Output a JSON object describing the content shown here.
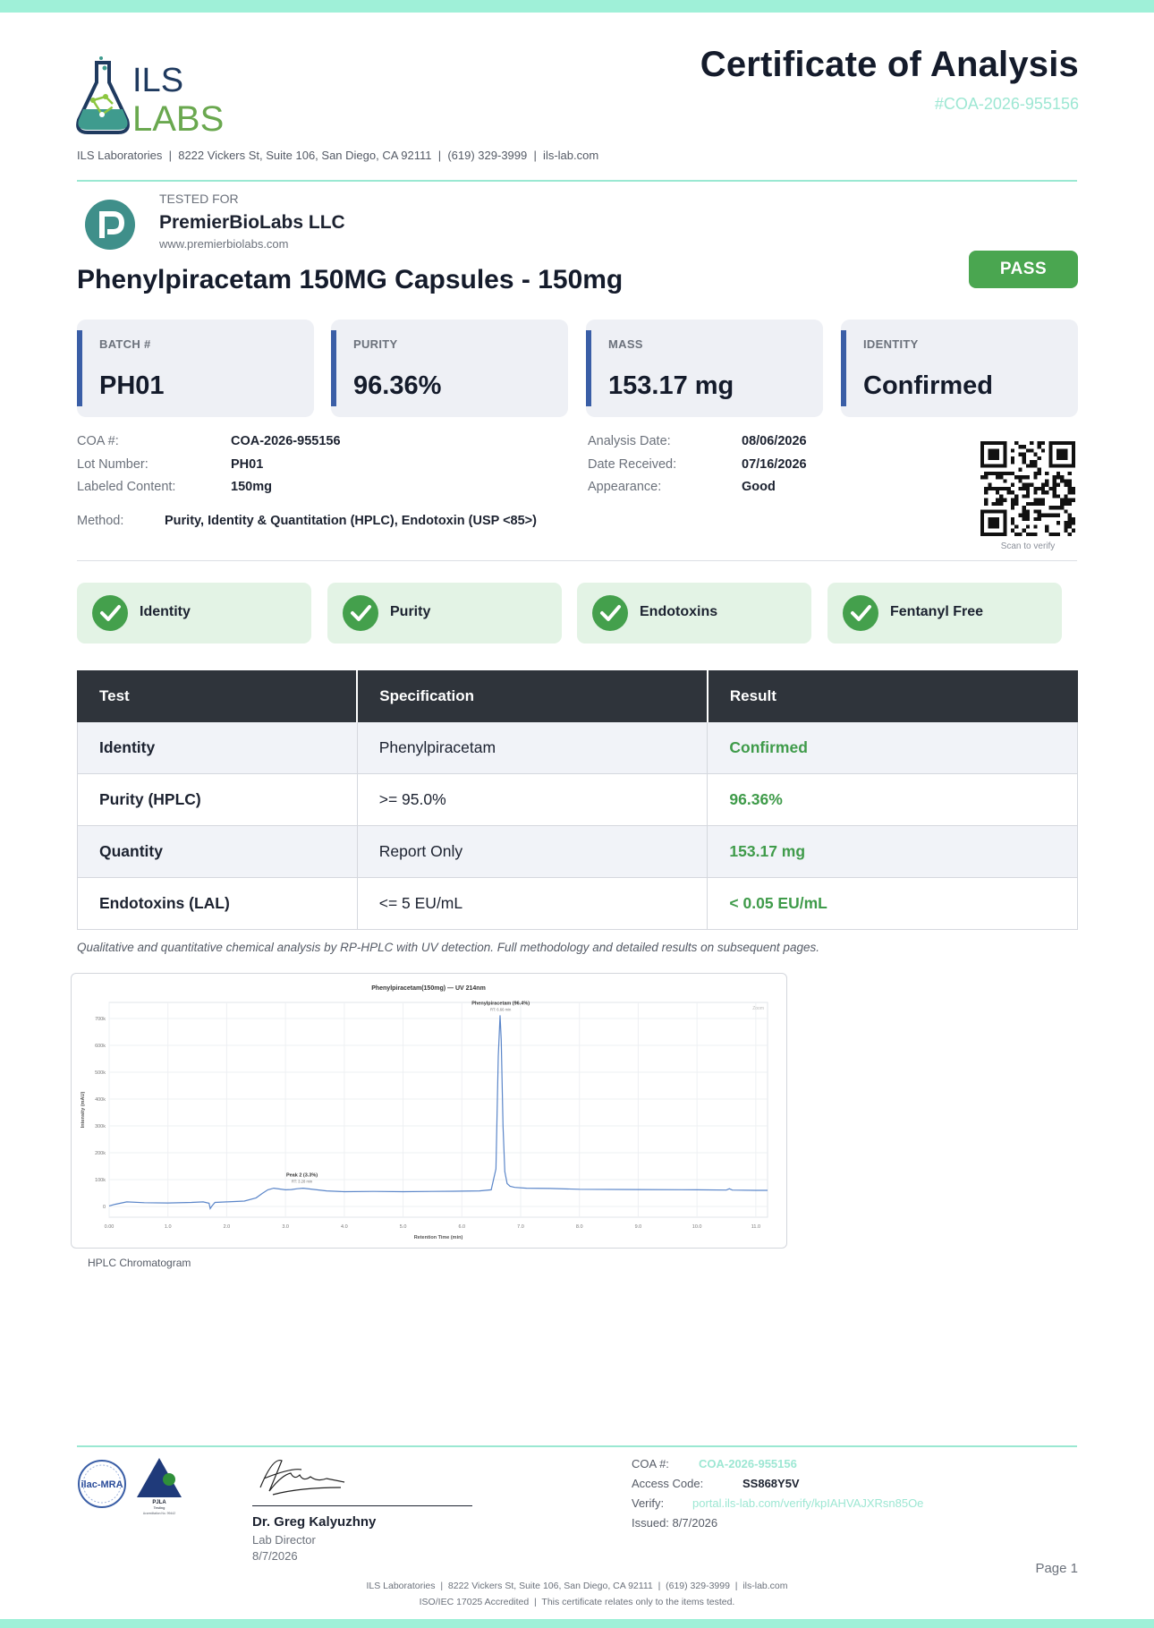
{
  "header": {
    "logo_line1": "ILS",
    "logo_line2": "LABS",
    "title": "Certificate of Analysis",
    "coa_id": "#COA-2026-955156",
    "lab_line": "ILS Laboratories  |  8222 Vickers St, Suite 106, San Diego, CA 92111  |  (619) 329-3999  |  ils-lab.com"
  },
  "client": {
    "tested_for_label": "TESTED FOR",
    "name": "PremierBioLabs LLC",
    "url": "www.premierbiolabs.com"
  },
  "product": {
    "name": "Phenylpiracetam 150MG Capsules - 150mg",
    "status": "PASS"
  },
  "cards": [
    {
      "label": "BATCH #",
      "value": "PH01"
    },
    {
      "label": "PURITY",
      "value": "96.36%"
    },
    {
      "label": "MASS",
      "value": "153.17 mg"
    },
    {
      "label": "IDENTITY",
      "value": "Confirmed"
    }
  ],
  "info_left": [
    {
      "k": "COA #:",
      "v": "COA-2026-955156"
    },
    {
      "k": "Lot Number:",
      "v": "PH01"
    },
    {
      "k": "Labeled Content:",
      "v": "150mg"
    }
  ],
  "info_right": [
    {
      "k": "Analysis Date:",
      "v": "08/06/2026"
    },
    {
      "k": "Date Received:",
      "v": "07/16/2026"
    },
    {
      "k": "Appearance:",
      "v": "Good"
    }
  ],
  "method": {
    "k": "Method:",
    "v": "Purity, Identity & Quantitation (HPLC), Endotoxin (USP <85>)"
  },
  "qr_caption": "Scan to verify",
  "checks": [
    "Identity",
    "Purity",
    "Endotoxins",
    "Fentanyl Free"
  ],
  "table": {
    "headers": [
      "Test",
      "Specification",
      "Result"
    ],
    "rows": [
      {
        "test": "Identity",
        "spec": "Phenylpiracetam",
        "result": "Confirmed"
      },
      {
        "test": "Purity (HPLC)",
        "spec": ">= 95.0%",
        "result": "96.36%"
      },
      {
        "test": "Quantity",
        "spec": "Report Only",
        "result": "153.17 mg"
      },
      {
        "test": "Endotoxins (LAL)",
        "spec": "<= 5 EU/mL",
        "result": "< 0.05 EU/mL"
      }
    ]
  },
  "note": "Qualitative and quantitative chemical analysis by RP-HPLC with UV detection. Full methodology and detailed results on subsequent pages.",
  "chart_data": {
    "type": "line",
    "title": "Phenylpiracetam(150mg) — UV 214nm",
    "xlabel": "Retention Time (min)",
    "ylabel": "Intensity (mAU)",
    "xlim": [
      0,
      11.2
    ],
    "ylim": [
      -40000,
      760000
    ],
    "x_ticks": [
      "0.00",
      "1.0",
      "2.0",
      "3.0",
      "4.0",
      "5.0",
      "6.0",
      "7.0",
      "8.0",
      "9.0",
      "10.0",
      "11.0"
    ],
    "y_ticks": [
      "0",
      "100k",
      "200k",
      "300k",
      "400k",
      "500k",
      "600k",
      "700k"
    ],
    "grid": true,
    "corner_label": "Zoom",
    "annotations": [
      {
        "label": "Phenylpiracetam (96.4%)",
        "sub": "RT: 6.66 min",
        "x": 6.66,
        "y": 712000
      },
      {
        "label": "Peak 2 (3.3%)",
        "sub": "RT: 3.28 min",
        "x": 3.28,
        "y": 72000
      }
    ],
    "series": [
      {
        "x": [
          0.0,
          0.1,
          0.3,
          0.6,
          1.0,
          1.4,
          1.6,
          1.7,
          1.72,
          1.75,
          1.8,
          2.0,
          2.3,
          2.5,
          2.6,
          2.7,
          2.8,
          2.9,
          3.0,
          3.1,
          3.2,
          3.3,
          3.5,
          3.7,
          4.0,
          4.5,
          5.0,
          5.5,
          6.0,
          6.3,
          6.5,
          6.58,
          6.62,
          6.65,
          6.67,
          6.7,
          6.73,
          6.77,
          6.82,
          6.9,
          7.1,
          7.5,
          8.0,
          9.0,
          10.0,
          10.5,
          10.55,
          10.6,
          11.0,
          11.2
        ],
        "y": [
          2000,
          8000,
          17000,
          14000,
          13000,
          15000,
          17000,
          12000,
          -8000,
          2000,
          15000,
          17000,
          20000,
          32000,
          48000,
          62000,
          68000,
          65000,
          62000,
          63000,
          66000,
          68000,
          63000,
          58000,
          55000,
          56000,
          55000,
          56000,
          57000,
          58000,
          62000,
          140000,
          560000,
          712000,
          620000,
          300000,
          130000,
          85000,
          75000,
          71000,
          68000,
          67000,
          64000,
          63000,
          62000,
          61000,
          66000,
          61000,
          60000,
          60000
        ]
      }
    ]
  },
  "chart_caption": "HPLC Chromatogram",
  "footer": {
    "seal1": "ilac-MRA",
    "seal2": "PJLA",
    "seal2_sub": "Testing",
    "seal2_accr": "Accreditation No. 99442",
    "signer_name": "Dr. Greg Kalyuzhny",
    "signer_role": "Lab Director",
    "signer_date": "8/7/2026",
    "coa_label": "COA #:",
    "coa_value": "COA-2026-955156",
    "access_label": "Access Code:",
    "access_value": "SS868Y5V",
    "verify_label": "Verify:",
    "verify_value": "portal.ils-lab.com/verify/kpIAHVAJXRsn85Oe",
    "issued": "Issued: 8/7/2026",
    "page": "Page 1",
    "line1": "ILS Laboratories  |  8222 Vickers St, Suite 106, San Diego, CA 92111  |  (619) 329-3999  |  ils-lab.com",
    "line2": "ISO/IEC 17025 Accredited  |  This certificate relates only to the items tested."
  },
  "colors": {
    "teal": "#9ae8d2",
    "pass_green": "#4aa650",
    "result_green": "#3f9b4a",
    "card_accent": "#3a5ea6",
    "table_header": "#2f343b",
    "chart_line": "#5b86c9"
  }
}
